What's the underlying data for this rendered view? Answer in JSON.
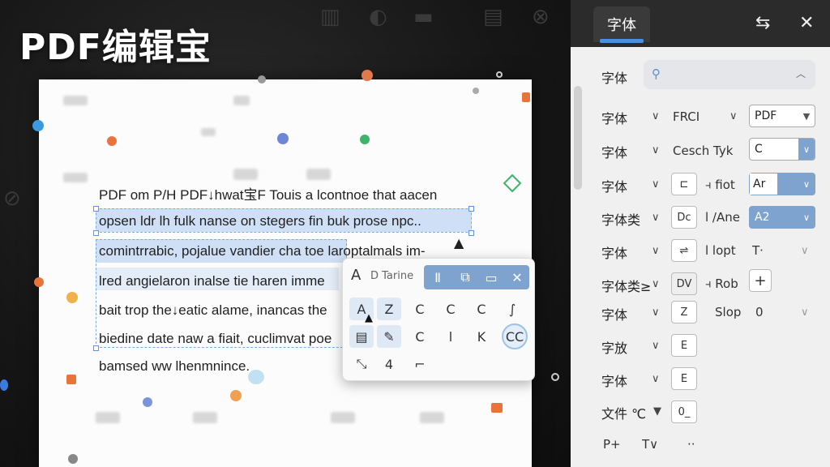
{
  "app": {
    "brand": "PDF编辑宝"
  },
  "document": {
    "lines": [
      "PDF om P/H PDF↓hwat宝F Touis a lcontnoe that aacen",
      "opsen ldr lh fulk nanse on stegers fin buk prose npc..",
      "comintrrabic, pojalue vandier cha toe laroptalmals im-",
      "lred angielaron inalse tie haren imme",
      "bait trop the↓eatic alame, inancas the",
      "biedine date naw a fiait, cuclimvat poe",
      "bamsed ww lhenmnince."
    ]
  },
  "float_toolbar": {
    "header_letter": "A",
    "font_name": "D Tarine",
    "header_icons": [
      "Ⅱ",
      "⧉",
      "▭",
      "✕"
    ],
    "row1": [
      "A",
      "Z",
      "C",
      "C",
      "C",
      "∫"
    ],
    "row2": [
      "▤",
      "✎",
      "C",
      "l",
      "K",
      "CC"
    ],
    "row3": [
      "⤡",
      "4",
      "⌐"
    ]
  },
  "panel": {
    "tab_label": "字体",
    "search_label": "字体",
    "rows": [
      {
        "label": "字体",
        "mid": "FRCI",
        "value": "PDF"
      },
      {
        "label": "字体",
        "mid": "Cesch  Tyk",
        "value": "C"
      },
      {
        "label": "字体",
        "icon": "⊏",
        "mid": "⫞ fiot",
        "value": "Ar"
      },
      {
        "label": "字体类",
        "icon": "Dc",
        "mid": "l /Ane",
        "value": "A2"
      },
      {
        "label": "字体",
        "icon": "⇌",
        "mid": "l lopt",
        "value": "T·"
      },
      {
        "label": "字体类≥",
        "icon": "DV",
        "mid": "⫞ Rob",
        "value": "+"
      },
      {
        "label": "字体",
        "icon": "Z",
        "mid": "Slop",
        "value": "0"
      },
      {
        "label": "字放",
        "icon": "E"
      },
      {
        "label": "字体",
        "icon": "E"
      },
      {
        "label": "文件 ℃",
        "icon": "0_"
      }
    ],
    "bottom": [
      "P+",
      "T∨",
      "··"
    ]
  }
}
